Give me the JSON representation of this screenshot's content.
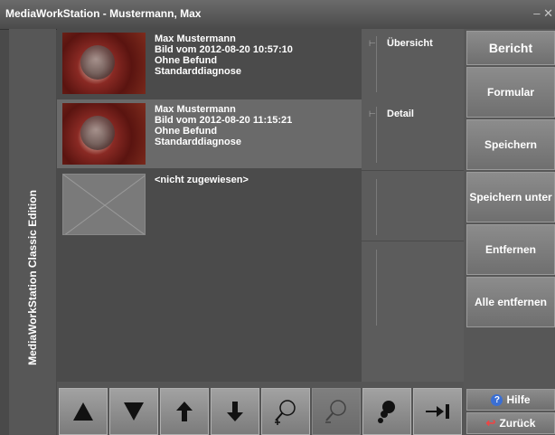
{
  "window": {
    "title": "MediaWorkStation - Mustermann, Max",
    "controls": "– ✕"
  },
  "sidebar": {
    "label": "MediaWorkStation Classic Edition"
  },
  "images": [
    {
      "lines": [
        "Max Mustermann",
        "Bild vom 2012-08-20 10:57:10",
        "Ohne Befund",
        "Standarddiagnose"
      ]
    },
    {
      "lines": [
        "Max Mustermann",
        "Bild vom 2012-08-20 11:15:21",
        "Ohne Befund",
        "Standarddiagnose"
      ]
    },
    {
      "lines": [
        "<nicht zugewiesen>",
        "",
        "",
        ""
      ]
    }
  ],
  "slots": [
    {
      "label": "Übersicht"
    },
    {
      "label": "Detail"
    },
    {
      "label": ""
    },
    {
      "label": ""
    }
  ],
  "actions": {
    "bericht": "Bericht",
    "formular": "Formular",
    "speichern": "Speichern",
    "speichern_unter": "Speichern unter",
    "entfernen": "Entfernen",
    "alle_entfernen": "Alle entfernen",
    "hilfe": "Hilfe",
    "zurueck": "Zurück"
  },
  "colors": {
    "accent_help": "#3b6fd4",
    "accent_back": "#e44444"
  }
}
